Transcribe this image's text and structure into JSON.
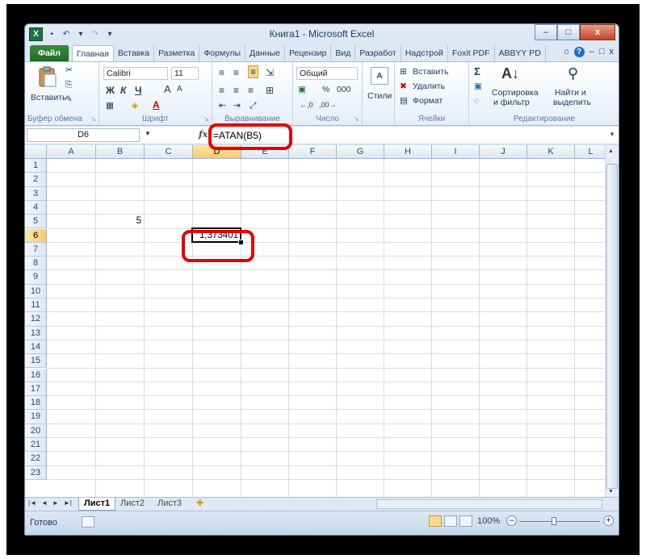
{
  "window": {
    "title": "Книга1 - Microsoft Excel",
    "logo": "X",
    "controls": [
      "–",
      "□",
      "x"
    ]
  },
  "ribbon_tabs": [
    "Файл",
    "Главная",
    "Вставка",
    "Разметка",
    "Формулы",
    "Данные",
    "Рецензир",
    "Вид",
    "Разработ",
    "Надстрой",
    "Foxit PDF",
    "ABBYY PD"
  ],
  "ribbon_tab_icons": [
    "⌂",
    "?",
    "–",
    "□",
    "x"
  ],
  "ribbon": {
    "clipboard": {
      "paste_label": "Вставить",
      "group_label": "Буфер обмена"
    },
    "font": {
      "font_name": "Calibri",
      "font_size": "11",
      "bold": "Ж",
      "italic": "К",
      "underline": "Ч",
      "grow": "A",
      "shrink": "A",
      "group_label": "Шрифт"
    },
    "alignment": {
      "group_label": "Выравнивание"
    },
    "number": {
      "format": "Общий",
      "percent": "%",
      "thousands": "000",
      "group_label": "Число"
    },
    "styles": {
      "label": "Стили"
    },
    "cells": {
      "insert": "Вставить",
      "delete": "Удалить",
      "format": "Формат",
      "group_label": "Ячейки"
    },
    "editing": {
      "sigma": "Σ",
      "sort": "Сортировка",
      "sort2": "и фильтр",
      "find": "Найти и",
      "find2": "выделить",
      "group_label": "Редактирование"
    }
  },
  "formula_bar": {
    "name_box": "D6",
    "fx": "fx",
    "formula": "=ATAN(B5)"
  },
  "columns": [
    "A",
    "B",
    "C",
    "D",
    "E",
    "F",
    "G",
    "H",
    "I",
    "J",
    "K",
    "L"
  ],
  "rows": [
    "1",
    "2",
    "3",
    "4",
    "5",
    "6",
    "7",
    "8",
    "9",
    "10",
    "11",
    "12",
    "13",
    "14",
    "15",
    "16",
    "17",
    "18",
    "19",
    "20",
    "21",
    "22",
    "23"
  ],
  "cells": {
    "B5": "5",
    "D6": "1,373401"
  },
  "sheets": [
    "Лист1",
    "Лист2",
    "Лист3"
  ],
  "status": {
    "ready": "Готово",
    "zoom": "100%",
    "zoom_minus": "–",
    "zoom_plus": "+"
  },
  "colors": {
    "highlight": "#e30000",
    "file_tab": "#2e7d32",
    "selected_header": "#f8c970"
  }
}
